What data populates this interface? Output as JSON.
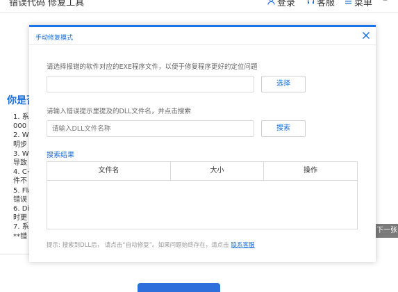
{
  "app": {
    "title": "错误代码 修复工具",
    "nav": [
      {
        "label": "登录",
        "icon": "user-icon"
      },
      {
        "label": "客服",
        "icon": "headset-icon"
      },
      {
        "label": "菜单",
        "icon": "menu-icon"
      }
    ],
    "close_glyph": "–"
  },
  "background": {
    "heading": "你是否",
    "list": [
      "1. 系",
      "000",
      "2. Wi",
      "明步",
      "3. Wi",
      "导致",
      "4. C+",
      "件不",
      "5. Fla",
      "错误",
      "6. Dir",
      "时更",
      "7. 系",
      "**错"
    ],
    "next_label": "下一张"
  },
  "dialog": {
    "title": "手动修复模式",
    "exe_prompt": "请选择报错的软件对应的EXE程序文件，以便于修复程序更好的定位问题",
    "exe_value": "",
    "select_button": "选择",
    "dll_prompt": "请输入错误提示里提及的DLL文件名，并点击搜索",
    "dll_placeholder": "请输入DLL文件名称",
    "search_button": "搜索",
    "results_title": "搜索结果",
    "columns": [
      "文件名",
      "大小",
      "操作"
    ],
    "rows": [],
    "tip_text": "提示:   搜索到DLL后，  请点击“自动修复”。如果问题始终存在，请点击",
    "tip_link": "联系客服"
  },
  "colors": {
    "accent": "#1a73e8",
    "link": "#1a6fd8",
    "next_badge": "#7a7a7a"
  }
}
